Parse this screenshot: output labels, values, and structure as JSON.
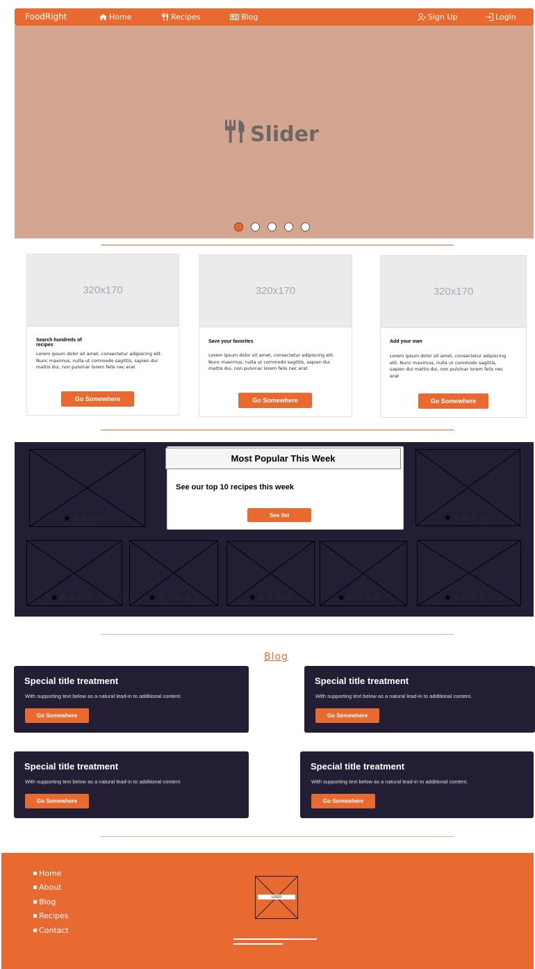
{
  "nav": {
    "brand": "FoodRight",
    "home": "Home",
    "recipes": "Recipes",
    "blog": "Blog",
    "signup": "Sign Up",
    "login": "Login"
  },
  "slider": {
    "title": "Slider",
    "active_index": 0,
    "dot_count": 5
  },
  "features": [
    {
      "placeholder": "320x170",
      "title": "Search hundreds of recipes",
      "text": "Lorem ipsum dolor sit amet, consectetur adipiscing elit. Nunc maximus, nulla ut commodo sagittis, sapien dui mattis dui, non pulvinar lorem felis nec erat",
      "button": "Go Somewhere"
    },
    {
      "placeholder": "320x170",
      "title": "Save your favorites",
      "text": "Lorem ipsum dolor sit amet, consectetur adipiscing elit. Nunc maximus, nulla ut commodo sagittis, sapien dui mattis dui, non pulvinar lorem felis nec erat",
      "button": "Go Somewhere"
    },
    {
      "placeholder": "320x170",
      "title": "Add your own",
      "text": "Lorem ipsum dolor sit amet, consectetur adipiscing elit. Nunc maximus, nulla ut commodo sagittis, sapien dui mattis dui, non pulvinar lorem felis nec erat",
      "button": "Go Somewhere"
    }
  ],
  "popular": {
    "title": "Most Popular This Week",
    "subtitle": "See our top 10 recipes this week",
    "button": "See list",
    "ratings": [
      1,
      1,
      1,
      1,
      1,
      1,
      1
    ],
    "max_rating": 5
  },
  "blog": {
    "heading": "Blog",
    "posts": [
      {
        "title": "Special title treatment",
        "text": "With supporting text below as a natural lead-in to additional content.",
        "button": "Go Somewhere"
      },
      {
        "title": "Special title treatment",
        "text": "With supporting text below as a natural lead-in to additional content.",
        "button": "Go Somewhere"
      },
      {
        "title": "Special title treatment",
        "text": "With supporting text below as a natural lead-in to additional content.",
        "button": "Go Somewhere"
      },
      {
        "title": "Special title treatment",
        "text": "With supporting text below as a natural lead-in to additional content.",
        "button": "Go Somewhere"
      }
    ]
  },
  "footer": {
    "links": [
      "Home",
      "About",
      "Blog",
      "Recipes",
      "Contact"
    ],
    "logo": "LOGO"
  },
  "colors": {
    "accent": "#e96a30",
    "dark": "#241e34",
    "slider_bg": "#d4a590"
  },
  "icons": {
    "home": "home-icon",
    "recipes": "fork-knife-icon",
    "blog": "newspaper-icon",
    "signup": "user-plus-icon",
    "login": "login-icon"
  }
}
